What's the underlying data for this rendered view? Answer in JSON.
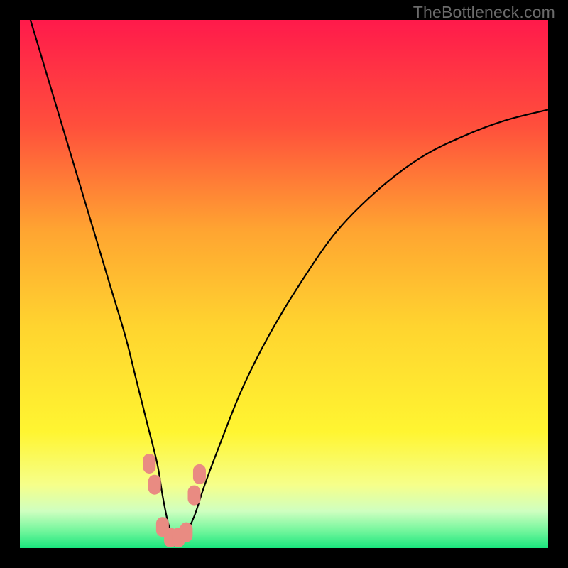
{
  "watermark": "TheBottleneck.com",
  "chart_data": {
    "type": "line",
    "title": "",
    "xlabel": "",
    "ylabel": "",
    "xlim": [
      0,
      100
    ],
    "ylim": [
      0,
      100
    ],
    "legend": false,
    "grid": false,
    "background_gradient": {
      "stops": [
        {
          "pos": 0.0,
          "color": "#ff1a4b"
        },
        {
          "pos": 0.2,
          "color": "#ff4f3c"
        },
        {
          "pos": 0.4,
          "color": "#ffa531"
        },
        {
          "pos": 0.58,
          "color": "#ffd42f"
        },
        {
          "pos": 0.78,
          "color": "#fff531"
        },
        {
          "pos": 0.88,
          "color": "#f6ff8a"
        },
        {
          "pos": 0.93,
          "color": "#cfffc0"
        },
        {
          "pos": 0.97,
          "color": "#6cf59a"
        },
        {
          "pos": 1.0,
          "color": "#19e57d"
        }
      ]
    },
    "series": [
      {
        "name": "bottleneck-curve",
        "color": "#000000",
        "x": [
          2,
          5,
          8,
          11,
          14,
          17,
          20,
          22,
          24,
          26,
          27,
          28,
          29,
          30,
          31,
          33,
          35,
          38,
          42,
          47,
          53,
          60,
          68,
          76,
          84,
          92,
          100
        ],
        "y": [
          100,
          90,
          80,
          70,
          60,
          50,
          40,
          32,
          24,
          16,
          10,
          5,
          2,
          1,
          2,
          6,
          12,
          20,
          30,
          40,
          50,
          60,
          68,
          74,
          78,
          81,
          83
        ]
      }
    ],
    "markers": {
      "name": "highlighted-points",
      "color": "#e98b82",
      "points": [
        {
          "x": 24.5,
          "y": 16
        },
        {
          "x": 25.5,
          "y": 12
        },
        {
          "x": 27.0,
          "y": 4
        },
        {
          "x": 28.5,
          "y": 2
        },
        {
          "x": 30.0,
          "y": 2
        },
        {
          "x": 31.5,
          "y": 3
        },
        {
          "x": 33.0,
          "y": 10
        },
        {
          "x": 34.0,
          "y": 14
        }
      ]
    }
  }
}
